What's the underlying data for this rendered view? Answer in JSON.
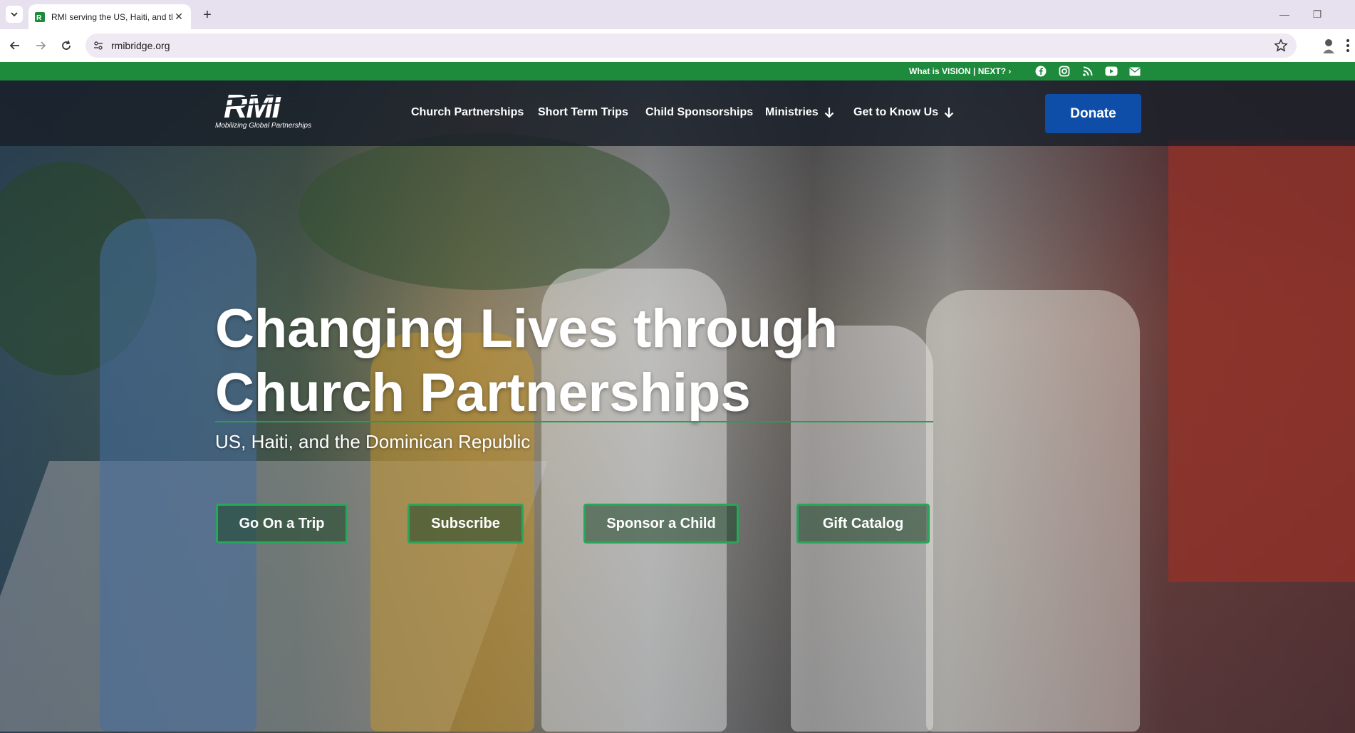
{
  "browser": {
    "tab_title": "RMI serving the US, Haiti, and th",
    "url": "rmibridge.org"
  },
  "topbar": {
    "vision_link": "What is VISION | NEXT? ›",
    "social_icons": [
      "facebook-icon",
      "instagram-icon",
      "rss-icon",
      "youtube-icon",
      "email-icon"
    ]
  },
  "header": {
    "logo_text": "RMI",
    "logo_tagline": "Mobilizing Global Partnerships",
    "nav": [
      {
        "label": "Church Partnerships"
      },
      {
        "label": "Short Term Trips"
      },
      {
        "label": "Child Sponsorships"
      },
      {
        "label": "Ministries"
      },
      {
        "label": "Get to Know Us"
      }
    ],
    "donate_label": "Donate"
  },
  "hero": {
    "headline_line1": "Changing Lives through",
    "headline_line2": "Church Partnerships",
    "subheading": "US, Haiti, and the Dominican Republic",
    "buttons": [
      {
        "label": "Go On a Trip"
      },
      {
        "label": "Subscribe"
      },
      {
        "label": "Sponsor a Child"
      },
      {
        "label": "Gift Catalog"
      }
    ]
  },
  "colors": {
    "topbar_green": "#1d8a3c",
    "donate_blue": "#0f4ea8",
    "cta_border_green": "#28a65a"
  }
}
